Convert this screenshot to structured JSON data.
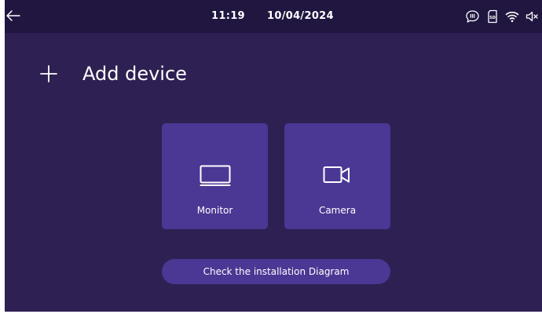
{
  "status_bar": {
    "time": "11:19",
    "date": "10/04/2024",
    "icons": [
      "intercom-talk-icon",
      "sd-card-icon",
      "wifi-icon",
      "speaker-muted-icon"
    ],
    "sd_label": "SD"
  },
  "header": {
    "title": "Add device"
  },
  "devices": [
    {
      "label": "Monitor",
      "icon": "monitor-icon"
    },
    {
      "label": "Camera",
      "icon": "camera-icon"
    }
  ],
  "diagram_button": {
    "label": "Check the installation Diagram"
  },
  "colors": {
    "background": "#2e2052",
    "status_bar": "#201640",
    "tile": "#4b3794",
    "text": "#ffffff"
  }
}
